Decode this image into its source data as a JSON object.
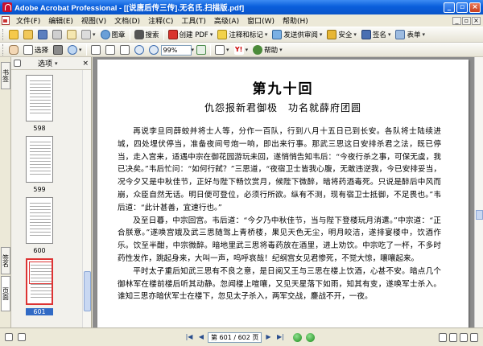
{
  "window": {
    "title": "Adobe Acrobat Professional - [[说唐后传三传].无名氏.扫描版.pdf]",
    "minimize": "_",
    "restore": "▫",
    "close": "×"
  },
  "menu": {
    "items": [
      "文件(F)",
      "编辑(E)",
      "视图(V)",
      "文档(D)",
      "注释(C)",
      "工具(T)",
      "高级(A)",
      "窗口(W)",
      "帮助(H)"
    ]
  },
  "toolbar1": {
    "items": [
      {
        "label": "图章",
        "icon": "stamp-icon"
      },
      {
        "label": "搜索",
        "icon": "binoculars-icon"
      },
      {
        "label": "创建 PDF",
        "icon": "create-pdf-icon"
      },
      {
        "label": "注释和标记",
        "icon": "comment-icon"
      },
      {
        "label": "发送供审阅",
        "icon": "send-review-icon"
      },
      {
        "label": "安全",
        "icon": "lock-icon"
      },
      {
        "label": "签名",
        "icon": "pen-icon"
      },
      {
        "label": "表单",
        "icon": "form-icon"
      }
    ]
  },
  "toolbar2": {
    "select_label": "选择",
    "zoom_value": "99%",
    "help_label": "帮助"
  },
  "panel": {
    "options_label": "选项",
    "tab_pages": "页面",
    "tab_signatures": "签名",
    "tab_bookmarks": "书签",
    "thumbnails": [
      {
        "label": "598",
        "current": false
      },
      {
        "label": "599",
        "current": false
      },
      {
        "label": "600",
        "current": false
      },
      {
        "label": "601",
        "current": true
      }
    ]
  },
  "document": {
    "chapter_title": "第九十回",
    "subtitle": "仇怨报新君御极　功名就薛府团圆",
    "paragraphs": [
      "再说李旦同薛蛟并将士人等，分作一百队，行到八月十五日已到长安。各队将士陆续进城，四处埋伏停当，准备夜间号炮一响，即出来行事。那武三思这日安排杀君之法，既已停当，走入宫来，适遇中宗在御花园游玩未回，遂悄悄告知韦后：“今夜行杀之事，可保无虞，我已决矣。”韦后忙问：“如何行弑？”三思道，“夜宿卫士皆我心腹，无敢违逆我，今已安排妥当，况今夕又是中秋佳节，正好与陛下畅饮赏月，候陛下微醉，暗将药酒毒死。只说是醉后中风而崩，众臣自然无话。明日便可登位，必须行所欲。纵有不测，现有宿卫士抵御，不足畏也。”韦后道：“此计甚善，宜速行也。”",
      "及至日暮，中宗回宫。韦后道：“今夕乃中秋佳节，当与陛下登楼玩月消遣。”中宗道：“正合朕意。”遂唤宫娥及武三思随驾上青桥楼，果见天色无尘，明月皎洁，遂排宴楼中，饮酒作乐。饮至半酣，中宗微醉。暗地里武三思将毒药放在酒里，进上劝饮。中宗吃了一杯，不多时药性发作，跳起身来，大叫一声，呜呼哀哉！纪纲宫女见君惨死，不觉大惊，嚷嚷起来。",
      "平时太子重后知武三思有不良之意，是日阅又王与三思在楼上饮酒，心甚不安。暗点几个御林军在楼前楼后听其动静。忽闻楼上喧嚷，又见天星落下如雨，知其有变，遂唤军士杀入。谁知三思亦暗伏军士在楼下，忽见太子杀入，两军交战，鏖战不开，一夜。"
    ]
  },
  "status": {
    "page_indicator": "第 601 / 602 页"
  },
  "colors": {
    "titlebar": "#0a5fdc",
    "selection": "#316ac5",
    "current_thumb_border": "#dd3333"
  }
}
